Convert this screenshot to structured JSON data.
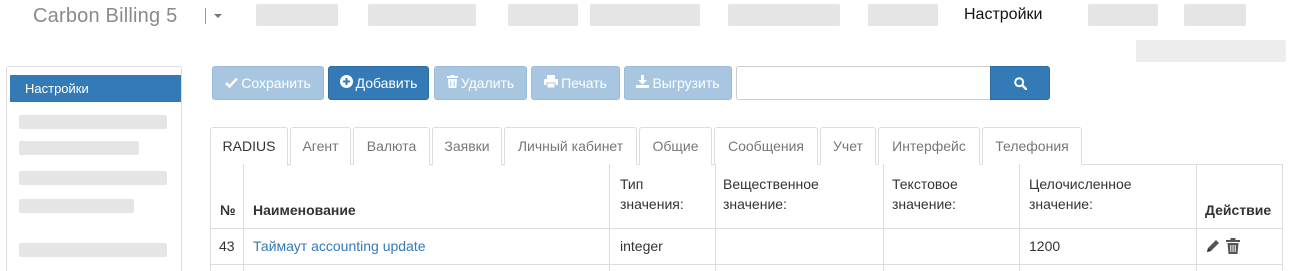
{
  "navbar": {
    "brand": "Carbon Billing 5",
    "active_item": "Настройки"
  },
  "sidebar": {
    "active_item": "Настройки"
  },
  "toolbar": {
    "save": "Сохранить",
    "add": "Добавить",
    "delete": "Удалить",
    "print": "Печать",
    "export": "Выгрузить",
    "search_value": ""
  },
  "tabs": [
    "RADIUS",
    "Агент",
    "Валюта",
    "Заявки",
    "Личный кабинет",
    "Общие",
    "Сообщения",
    "Учет",
    "Интерфейс",
    "Телефония"
  ],
  "table": {
    "headers": {
      "num": "№",
      "name": "Наименование",
      "type_l1": "Тип",
      "type_l2": "значения:",
      "real_l1": "Вещественное",
      "real_l2": "значение:",
      "text_l1": "Текстовое",
      "text_l2": "значение:",
      "int_l1": "Целочисленное",
      "int_l2": "значение:",
      "action": "Действие"
    },
    "rows": [
      {
        "num": "43",
        "name": "Таймаут accounting update",
        "type": "integer",
        "real": "",
        "text": "",
        "int": "1200"
      }
    ]
  },
  "icons": {
    "save": "check-icon",
    "add": "plus-circle-icon",
    "delete": "trash-icon",
    "print": "print-icon",
    "export": "download-icon",
    "search": "search-icon",
    "edit": "pencil-icon",
    "remove": "trash-icon"
  },
  "colors": {
    "primary": "#337ab7",
    "disabled": "#a9c6e0",
    "link": "#337ab7"
  }
}
